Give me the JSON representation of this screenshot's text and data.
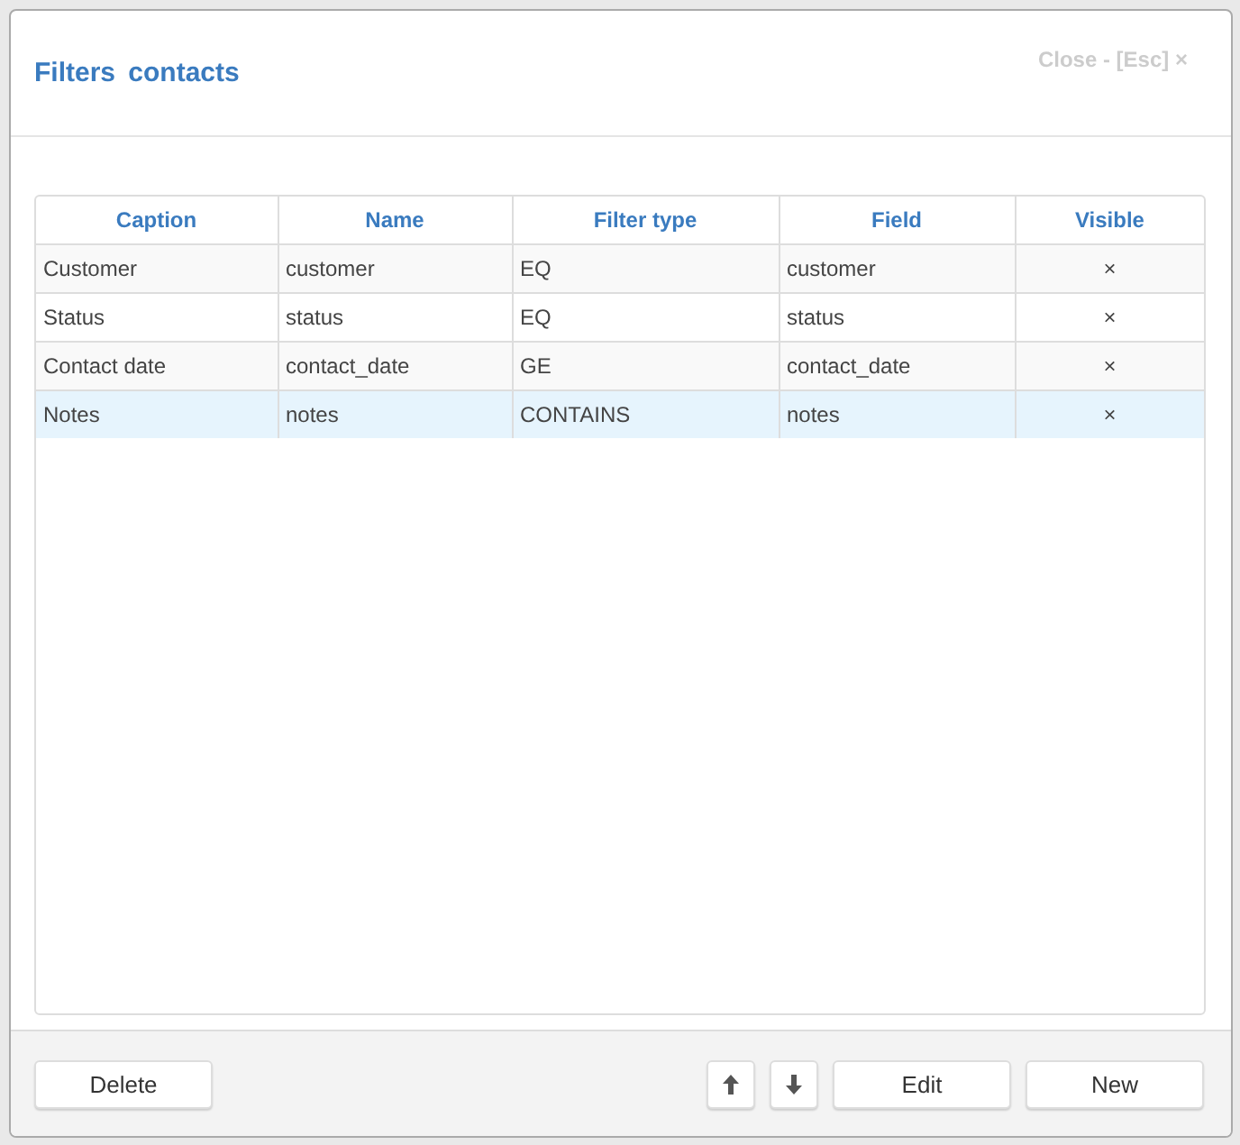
{
  "dialog": {
    "title": "Filters contacts",
    "close_label": "Close - [Esc] ×"
  },
  "table": {
    "columns": [
      "Caption",
      "Name",
      "Filter type",
      "Field",
      "Visible"
    ],
    "rows": [
      {
        "cells": [
          "Customer",
          "customer",
          "EQ",
          "customer",
          "×"
        ],
        "selected": false
      },
      {
        "cells": [
          "Status",
          "status",
          "EQ",
          "status",
          "×"
        ],
        "selected": false
      },
      {
        "cells": [
          "Contact date",
          "contact_date",
          "GE",
          "contact_date",
          "×"
        ],
        "selected": false
      },
      {
        "cells": [
          "Notes",
          "notes",
          "CONTAINS",
          "notes",
          "×"
        ],
        "selected": true
      }
    ]
  },
  "footer": {
    "left_buttons": [
      {
        "kind": "text",
        "label": "Delete"
      }
    ],
    "right_buttons": [
      {
        "kind": "up"
      },
      {
        "kind": "down"
      },
      {
        "kind": "text",
        "label": "Edit"
      },
      {
        "kind": "text",
        "label": "New"
      }
    ]
  }
}
